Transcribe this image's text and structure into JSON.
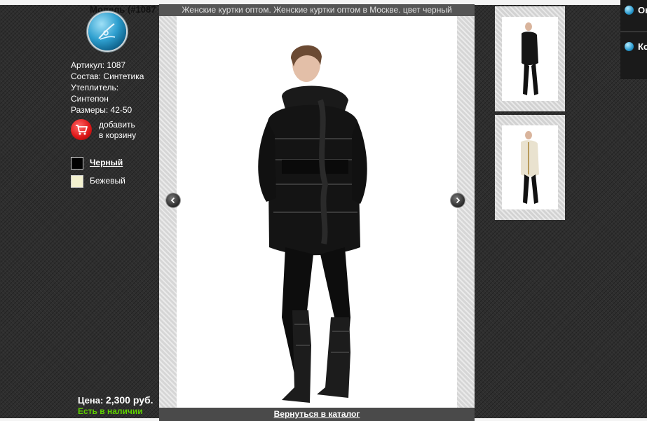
{
  "product": {
    "model_title": "Модель (#1087",
    "specs": {
      "article": "Артикул: 1087",
      "composition": "Состав: Синтетика",
      "insulation_label": "Утеплитель:",
      "insulation_value": "Синтепон",
      "sizes": "Размеры: 42-50"
    },
    "add_to_cart_line1": "добавить",
    "add_to_cart_line2": "в корзину",
    "colors": [
      {
        "name": "Черный",
        "hex": "#000000",
        "selected": true
      },
      {
        "name": "Бежевый",
        "hex": "#f3f1cf",
        "selected": false
      }
    ],
    "price_label": "Цена:",
    "price_value": "2,300 руб.",
    "stock_status": "Есть в наличии",
    "stock_color": "#5ed000"
  },
  "lightbox": {
    "title": "Женские куртки оптом. Женские куртки оптом в Москве. цвет черный",
    "back_link": "Вернуться в каталог",
    "prev_icon": "chevron-left-icon",
    "next_icon": "chevron-right-icon"
  },
  "thumbnails": [
    {
      "color": "black"
    },
    {
      "color": "beige"
    }
  ],
  "side_menu": {
    "items": [
      {
        "label": "Он"
      },
      {
        "label": "Ко"
      }
    ]
  }
}
